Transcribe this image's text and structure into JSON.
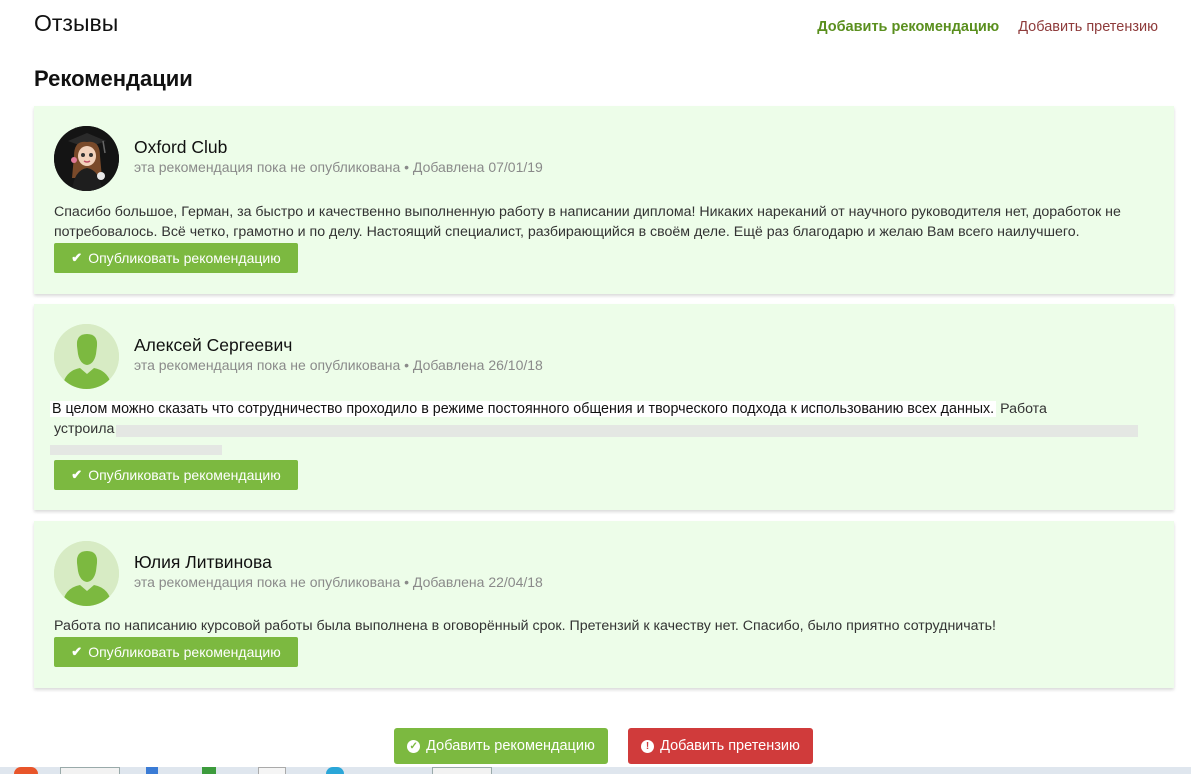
{
  "header": {
    "title": "Отзывы",
    "add_recommendation_link": "Добавить рекомендацию",
    "add_claim_link": "Добавить претензию"
  },
  "section": {
    "title": "Рекомендации"
  },
  "recommendations": [
    {
      "name": "Oxford Club",
      "meta": "эта рекомендация пока не опубликована • Добавлена 07/01/19",
      "text": "Спасибо большое, Герман, за быстро и качественно выполненную работу в написании диплома! Никаких нареканий от научного руководителя нет, доработок не потребовалось. Всё четко, грамотно и по делу. Настоящий специалист, разбирающийся в своём деле. Ещё раз благодарю и желаю Вам всего наилучшего.",
      "publish_label": "Опубликовать рекомендацию",
      "avatar": "graduate-photo-icon"
    },
    {
      "name": "Алексей Сергеевич",
      "meta": "эта рекомендация пока не опубликована • Добавлена 26/10/18",
      "text_highlight": "В целом можно сказать что сотрудничество проходило в режиме постоянного общения и творческого подхода к использованию всех данных.",
      "text_rest": "Работа",
      "text_line2": "устроила",
      "publish_label": "Опубликовать рекомендацию",
      "avatar": "default-user-icon"
    },
    {
      "name": "Юлия Литвинова",
      "meta": "эта рекомендация пока не опубликована • Добавлена 22/04/18",
      "text": "Работа по написанию курсовой работы была выполнена в оговорённый срок. Претензий к качеству нет. Спасибо, было приятно сотрудничать!",
      "publish_label": "Опубликовать рекомендацию",
      "avatar": "default-user-icon"
    }
  ],
  "actions": {
    "add_recommendation": "Добавить рекомендацию",
    "add_claim": "Добавить претензию"
  },
  "colors": {
    "card_bg": "#edfde9",
    "primary_green": "#7cb940",
    "danger_red": "#d03b3b",
    "link_green": "#5a8f1e",
    "link_red": "#8e3b3b"
  }
}
